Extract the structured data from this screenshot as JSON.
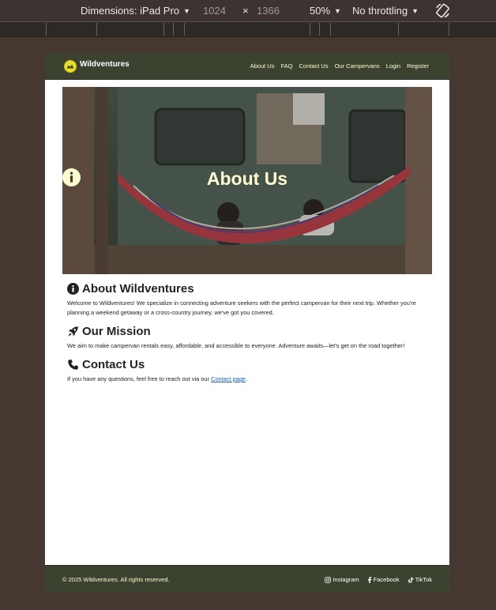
{
  "devtools": {
    "dimensions_label": "Dimensions: iPad Pro",
    "width": "1024",
    "times": "×",
    "height": "1366",
    "zoom": "50%",
    "throttle": "No throttling"
  },
  "nav": {
    "brand": "Wildventures",
    "links": [
      "About Us",
      "FAQ",
      "Contact Us",
      "Our Campervans",
      "Login",
      "Register"
    ]
  },
  "hero": {
    "title": "About Us"
  },
  "sections": [
    {
      "icon": "info-circle-icon",
      "heading": "About Wildventures",
      "text": "Welcome to Wildventures! We specialize in connecting adventure seekers with the perfect campervan for their next trip. Whether you're planning a weekend getaway or a cross-country journey, we've got you covered."
    },
    {
      "icon": "rocket-icon",
      "heading": "Our Mission",
      "text": "We aim to make campervan rentals easy, affordable, and accessible to everyone. Adventure awaits—let's get on the road together!"
    },
    {
      "icon": "phone-icon",
      "heading": "Contact Us",
      "text_before": "If you have any questions, feel free to reach out via our ",
      "link": "Contact page",
      "text_after": "."
    }
  ],
  "footer": {
    "copyright": "© 2025 Wildventures. All rights reserved.",
    "socials": [
      "Instagram",
      "Facebook",
      "TikTok"
    ]
  },
  "colors": {
    "nav_bg": "#3b4330",
    "accent": "#fffbd0",
    "link": "#1a58c7",
    "backdrop": "#453831"
  }
}
